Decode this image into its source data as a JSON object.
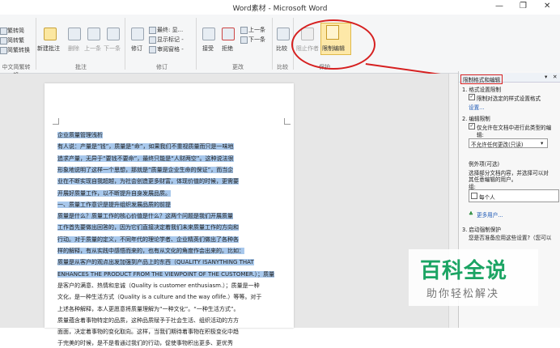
{
  "window": {
    "title": "Word素材 - Microsoft Word",
    "minimize": "—",
    "restore": "❐",
    "close": "✕"
  },
  "ribbon": {
    "left": {
      "items": [
        "繁转简",
        "简转繁",
        "简繁转换"
      ],
      "group": "中文简繁转换"
    },
    "comments": {
      "new": "新建批注",
      "delete": "删除",
      "prev": "上一条",
      "next": "下一条",
      "group": "批注"
    },
    "tracking": {
      "track": "修订",
      "markup": "最终: 显...",
      "show_markup": "显示标记 -",
      "review_pane": "审阅窗格 -",
      "group": "修订"
    },
    "changes": {
      "accept": "接受",
      "reject": "拒绝",
      "prev": "上一条",
      "next": "下一条",
      "group": "更改"
    },
    "compare": {
      "label": "比较",
      "group": "比较"
    },
    "protect": {
      "block_authors": "阻止作者",
      "restrict_editing": "限制编辑",
      "group": "保护"
    }
  },
  "document": {
    "lines": [
      {
        "text": "企业质量管理浅析",
        "sel": true
      },
      {
        "text": "有人说：产量是“钱”，质量是“命”，如果我们不重视质量而只是一味地",
        "sel": true
      },
      {
        "text": "追求产量，无异于“要钱不要命”，最终只能是“人财两空”。这种说法很",
        "sel": true
      },
      {
        "text": "形象地说明了这样一个思想，那就是“质量是企业生命的保证”，而当企",
        "sel": true
      },
      {
        "text": "业在不断实现自我超越，为社会创造更多财富，体现价值的时候，更需要",
        "sel": true
      },
      {
        "text": "开展好质量工作，以不断提升自身发展品质。",
        "sel": true
      },
      {
        "text": "一、质量工作意识是提升组织发展品质的前提",
        "sel": true
      },
      {
        "text": "质量是什么？质量工作的核心价值是什么？这两个问题是我们开展质量",
        "sel": true
      },
      {
        "text": "工作首先要做出回答的，因为它们直接决定着我们未来质量工作的方向和",
        "sel": true
      },
      {
        "text": "行动。对于质量的定义，不同年代的理论学者、企业精英们做出了各种各",
        "sel": true
      },
      {
        "text": "样的解释，有从实践中感悟而来的，也有从文化的角度作会出来的。比如：",
        "sel": true
      },
      {
        "text": "质量是从客户的观点出发加强到产品上的东西（QUALITY ISANYTHING THAT",
        "sel": true
      },
      {
        "text": "ENHANCES THE PRODUCT FROM THE VIEWPOINT OF THE CUSTOMER.）；质量",
        "sel": true
      },
      {
        "text": "是客户的满意、热情和忠诚（Quality is customer enthusiasm.）；质量是一种",
        "sel": false
      },
      {
        "text": "文化，是一种生活方式（Quality is a culture and the way oflife.）等等。对于",
        "sel": false
      },
      {
        "text": "上述各种解释，本人更愿意将质量理解为“一种文化”。“一种生活方式”。",
        "sel": false
      },
      {
        "text": "质量蕴含着事物特定的品质，这种品质赋予于社会生活、组织活动的方方",
        "sel": false
      },
      {
        "text": "面面，决定着事物的变化取向。这样，当我们期待着事物在积极变化中趋",
        "sel": false
      },
      {
        "text": "于完美的时候，是不是看通过我们的行动，促使事物积出更多、更优秀",
        "sel": false
      }
    ]
  },
  "panel": {
    "title": "限制格式和编辑",
    "s1_heading": "1. 格式设置限制",
    "s1_check": "限制对选定的样式设置格式",
    "s1_link": "设置...",
    "s2_heading": "2. 编辑限制",
    "s2_check": "仅允许在文档中进行此类型的编",
    "s2_check2": "辑:",
    "s2_dropdown": "不允许任何更改(只读)",
    "exceptions_heading": "例外项(可选)",
    "exceptions_text1": "选择部分文档内容，并选择可以对",
    "exceptions_text2": "其任意编辑的用户。",
    "group_label": "组:",
    "everyone": "每个人",
    "more_users": "更多用户...",
    "s3_heading": "3. 启动强制保护",
    "s3_text": "您是否准备应用这些设置?（您可以"
  },
  "watermark": {
    "line1": "百科全说",
    "line2": "助你轻松解决"
  },
  "colors": {
    "selection": "#a8c8ec",
    "annotation": "#d62020",
    "watermark_green": "#1ba463"
  }
}
